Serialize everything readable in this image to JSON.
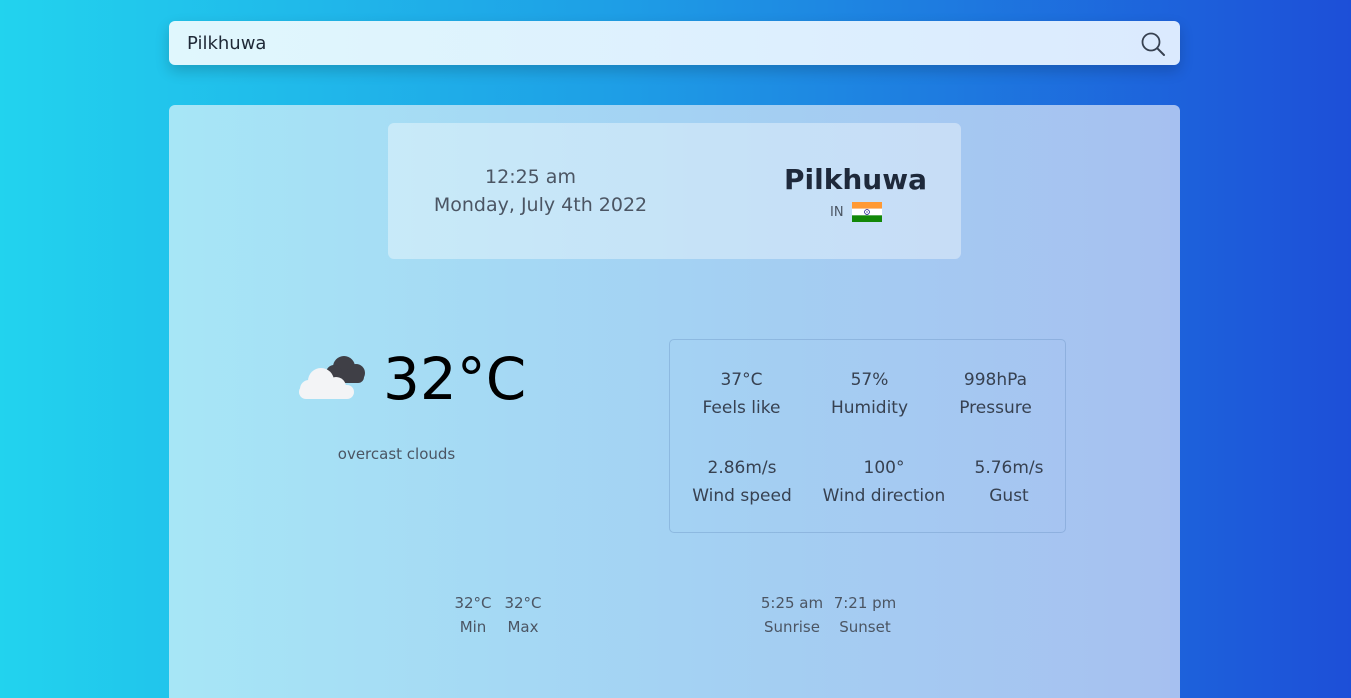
{
  "search": {
    "value": "Pilkhuwa",
    "icon": "search-icon"
  },
  "header": {
    "time": "12:25 am",
    "date": "Monday, July 4th 2022",
    "city": "Pilkhuwa",
    "country_code": "IN",
    "flag_icon": "india-flag-icon"
  },
  "current": {
    "icon": "overcast-clouds-icon",
    "temperature": "32°C",
    "description": "overcast clouds"
  },
  "stats": [
    {
      "value": "37°C",
      "label": "Feels like"
    },
    {
      "value": "57%",
      "label": "Humidity"
    },
    {
      "value": "998hPa",
      "label": "Pressure"
    },
    {
      "value": "2.86m/s",
      "label": "Wind speed"
    },
    {
      "value": "100°",
      "label": "Wind direction"
    },
    {
      "value": "5.76m/s",
      "label": "Gust"
    }
  ],
  "minmax": [
    {
      "value": "32°C",
      "label": "Min"
    },
    {
      "value": "32°C",
      "label": "Max"
    }
  ],
  "sun": [
    {
      "value": "5:25 am",
      "label": "Sunrise"
    },
    {
      "value": "7:21 pm",
      "label": "Sunset"
    }
  ],
  "colors": {
    "background_start": "#22d3ee",
    "background_end": "#1d4fd8",
    "text_dark": "#1e293b"
  }
}
